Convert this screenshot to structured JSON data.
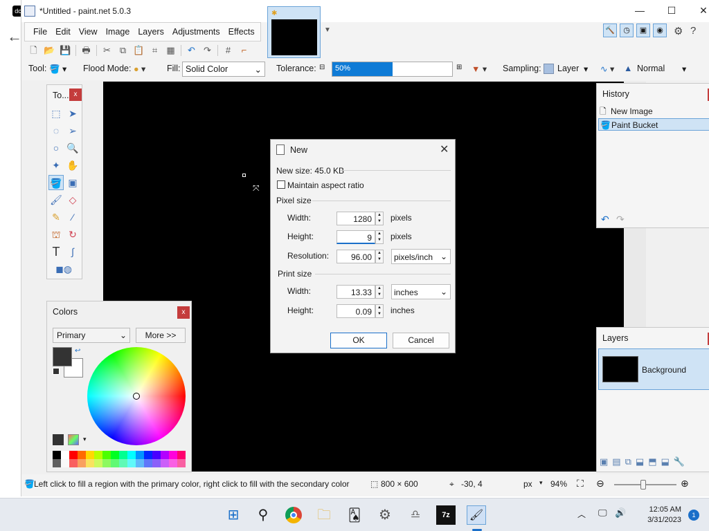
{
  "window": {
    "title": "*Untitled - paint.net 5.0.3"
  },
  "menu": [
    "File",
    "Edit",
    "View",
    "Image",
    "Layers",
    "Adjustments",
    "Effects"
  ],
  "settings": {
    "tool_label": "Tool:",
    "flood_mode_label": "Flood Mode:",
    "fill_label": "Fill:",
    "fill_value": "Solid Color",
    "tolerance_label": "Tolerance:",
    "tolerance_value": "50%",
    "tolerance_fraction": 0.5,
    "sampling_label": "Sampling:",
    "sampling_value": "Layer",
    "blend_value": "Normal"
  },
  "tools_panel": {
    "title": "To...",
    "close": "x"
  },
  "colors_panel": {
    "title": "Colors",
    "close": "x",
    "mode": "Primary",
    "more_label": "More >>",
    "primary_color": "#333333",
    "secondary_color": "#ffffff"
  },
  "history_panel": {
    "title": "History",
    "close": "x",
    "items": [
      "New Image",
      "Paint Bucket"
    ]
  },
  "layers_panel": {
    "title": "Layers",
    "close": "x",
    "layer_name": "Background"
  },
  "dialog": {
    "title": "New",
    "new_size": "New size: 45.0 KB",
    "maintain_aspect": "Maintain aspect ratio",
    "pixel_size_label": "Pixel size",
    "width_label": "Width:",
    "width_value": "1280",
    "width_unit": "pixels",
    "height_label": "Height:",
    "height_value": "9",
    "height_unit": "pixels",
    "resolution_label": "Resolution:",
    "resolution_value": "96.00",
    "resolution_unit": "pixels/inch",
    "print_size_label": "Print size",
    "print_width_label": "Width:",
    "print_width_value": "13.33",
    "print_width_unit": "inches",
    "print_height_label": "Height:",
    "print_height_value": "0.09",
    "print_height_unit": "inches",
    "ok_label": "OK",
    "cancel_label": "Cancel"
  },
  "status": {
    "hint": "Left click to fill a region with the primary color, right click to fill with the secondary color",
    "image_size": "800 × 600",
    "cursor_pos": "-30, 4",
    "unit": "px",
    "zoom": "94%"
  },
  "taskbar": {
    "time": "12:05 AM",
    "date": "3/31/2023",
    "notification_count": "1"
  }
}
